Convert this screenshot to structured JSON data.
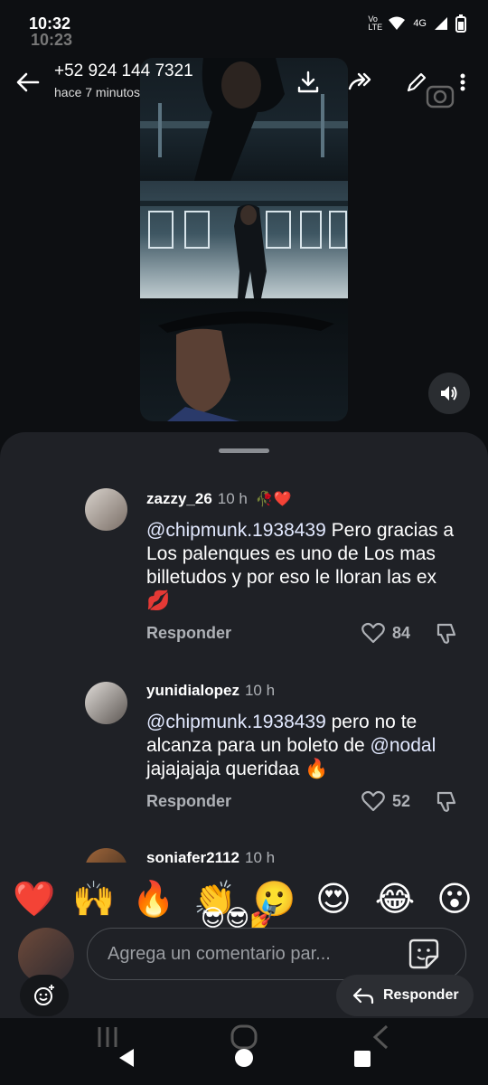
{
  "status": {
    "time": "10:32",
    "time_ghost": "10:23",
    "network": "4G",
    "volte": "Vo LTE",
    "signal_icon": "signal-icon",
    "battery_icon": "battery-icon"
  },
  "chat": {
    "contact": "+52 924 144 7321",
    "subtitle": "hace 7 minutos",
    "icons": [
      "back-arrow-icon",
      "download-icon",
      "forward-icon",
      "edit-icon",
      "more-vert-icon",
      "camera-icon"
    ]
  },
  "media": {
    "sound_icon": "volume-icon"
  },
  "comments": [
    {
      "user": "zazzy_26",
      "time": "10 h",
      "badge": "🥀❤️",
      "mention": "@chipmunk.1938439",
      "text": " Pero gracias a Los palenques es uno de Los mas billetudos y por eso le lloran las ex 💋",
      "reply": "Responder",
      "likes": "84"
    },
    {
      "user": "yunidialopez",
      "time": "10 h",
      "mention": "@chipmunk.1938439",
      "text_1": " pero no te alcanza para un boleto de ",
      "mention_2": "@nodal",
      "text_2": " jajajajaja queridaa 🔥",
      "reply": "Responder",
      "likes": "52"
    },
    {
      "user": "soniafer2112",
      "time": "10 h"
    }
  ],
  "emoji_bar": [
    "❤️",
    "🙌",
    "🔥",
    "👏",
    "🥲",
    "😍",
    "😂",
    "😮"
  ],
  "emoji_overlay": "😎😎💅",
  "input": {
    "placeholder": "Agrega un comentario par..."
  },
  "reply_button": "Responder",
  "colors": {
    "sheet": "#1f2126",
    "secondary_text": "#aeb1b6"
  }
}
